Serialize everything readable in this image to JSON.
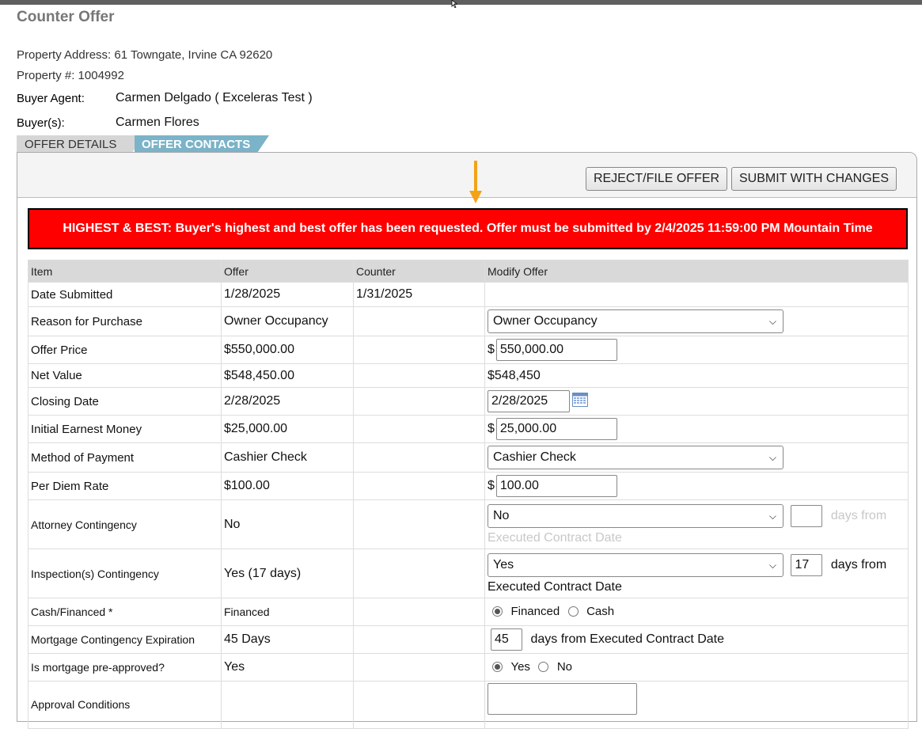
{
  "page": {
    "title": "Counter Offer"
  },
  "property": {
    "address_label": "Property Address:",
    "address": "61 Towngate, Irvine CA 92620",
    "number_label": "Property #:",
    "number": "1004992",
    "agent_label": "Buyer Agent:",
    "agent": "Carmen Delgado ( Exceleras Test )",
    "buyers_label": "Buyer(s):",
    "buyers": "Carmen Flores"
  },
  "tabs": [
    {
      "label": "OFFER DETAILS"
    },
    {
      "label": "OFFER CONTACTS"
    }
  ],
  "toolbar": {
    "reject_label": "REJECT/FILE OFFER",
    "submit_label": "SUBMIT WITH CHANGES"
  },
  "alert": {
    "text": "HIGHEST & BEST: Buyer's highest and best offer has been requested. Offer must be submitted by 2/4/2025 11:59:00 PM Mountain Time"
  },
  "table": {
    "headers": [
      "Item",
      "Offer",
      "Counter",
      "Modify Offer"
    ],
    "rows": {
      "date_submitted": {
        "item": "Date Submitted",
        "offer": "1/28/2025",
        "counter": "1/31/2025"
      },
      "reason": {
        "item": "Reason for Purchase",
        "offer": "Owner Occupancy",
        "select": "Owner Occupancy"
      },
      "offer_price": {
        "item": "Offer Price",
        "offer": "$550,000.00",
        "currency": "$",
        "input": "550,000.00"
      },
      "net_value": {
        "item": "Net Value",
        "offer": "$548,450.00",
        "modify": "$548,450"
      },
      "closing_date": {
        "item": "Closing Date",
        "offer": "2/28/2025",
        "input": "2/28/2025"
      },
      "earnest": {
        "item": "Initial Earnest Money",
        "offer": "$25,000.00",
        "currency": "$",
        "input": "25,000.00"
      },
      "payment": {
        "item": "Method of Payment",
        "offer": "Cashier Check",
        "select": "Cashier Check"
      },
      "per_diem": {
        "item": "Per Diem Rate",
        "offer": "$100.00",
        "currency": "$",
        "input": "100.00"
      },
      "attorney": {
        "item": "Attorney Contingency",
        "offer": "No",
        "select": "No",
        "days": "",
        "days_from": "days from",
        "ref": "Executed Contract Date"
      },
      "inspection": {
        "item": "Inspection(s) Contingency",
        "offer": "Yes (17 days)",
        "select": "Yes",
        "days": "17",
        "days_from": "days from",
        "ref": "Executed Contract Date"
      },
      "cash_financed": {
        "item": "Cash/Financed *",
        "offer": "Financed",
        "opt1": "Financed",
        "opt2": "Cash",
        "selected": "Financed"
      },
      "mortgage_exp": {
        "item": "Mortgage Contingency Expiration",
        "offer": "45 Days",
        "input": "45",
        "suffix": "days from Executed Contract Date"
      },
      "preapproved": {
        "item": "Is mortgage pre-approved?",
        "offer": "Yes",
        "opt1": "Yes",
        "opt2": "No",
        "selected": "Yes"
      },
      "approval": {
        "item": "Approval Conditions",
        "offer": ""
      }
    }
  },
  "colors": {
    "alert_bg": "#ff0000",
    "tab_active": "#7bb3c8",
    "tab_inactive": "#d6d6d6",
    "arrow": "#f2a316"
  }
}
